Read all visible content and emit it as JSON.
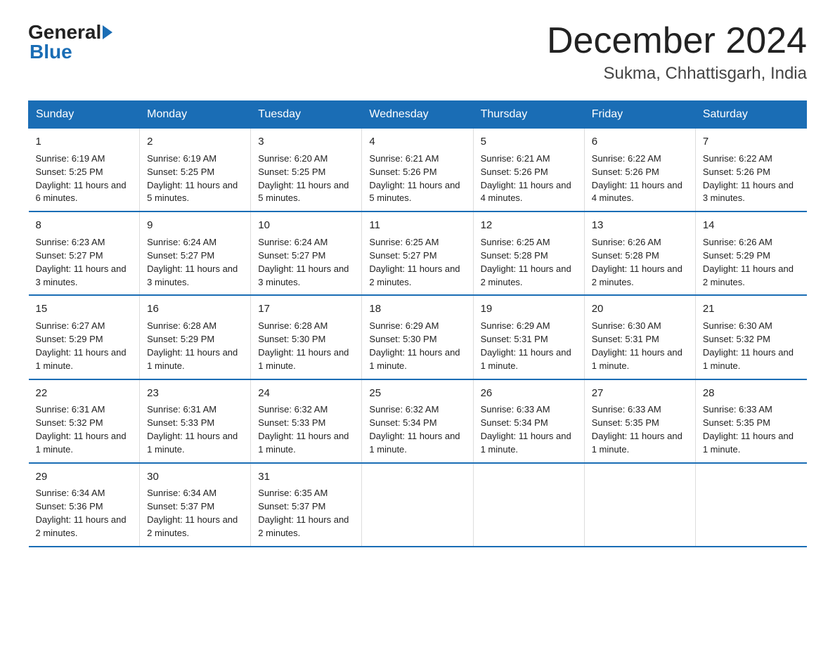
{
  "header": {
    "logo_general": "General",
    "logo_blue": "Blue",
    "month": "December 2024",
    "location": "Sukma, Chhattisgarh, India"
  },
  "days_of_week": [
    "Sunday",
    "Monday",
    "Tuesday",
    "Wednesday",
    "Thursday",
    "Friday",
    "Saturday"
  ],
  "weeks": [
    [
      {
        "day": "1",
        "sunrise": "6:19 AM",
        "sunset": "5:25 PM",
        "daylight": "11 hours and 6 minutes."
      },
      {
        "day": "2",
        "sunrise": "6:19 AM",
        "sunset": "5:25 PM",
        "daylight": "11 hours and 5 minutes."
      },
      {
        "day": "3",
        "sunrise": "6:20 AM",
        "sunset": "5:25 PM",
        "daylight": "11 hours and 5 minutes."
      },
      {
        "day": "4",
        "sunrise": "6:21 AM",
        "sunset": "5:26 PM",
        "daylight": "11 hours and 5 minutes."
      },
      {
        "day": "5",
        "sunrise": "6:21 AM",
        "sunset": "5:26 PM",
        "daylight": "11 hours and 4 minutes."
      },
      {
        "day": "6",
        "sunrise": "6:22 AM",
        "sunset": "5:26 PM",
        "daylight": "11 hours and 4 minutes."
      },
      {
        "day": "7",
        "sunrise": "6:22 AM",
        "sunset": "5:26 PM",
        "daylight": "11 hours and 3 minutes."
      }
    ],
    [
      {
        "day": "8",
        "sunrise": "6:23 AM",
        "sunset": "5:27 PM",
        "daylight": "11 hours and 3 minutes."
      },
      {
        "day": "9",
        "sunrise": "6:24 AM",
        "sunset": "5:27 PM",
        "daylight": "11 hours and 3 minutes."
      },
      {
        "day": "10",
        "sunrise": "6:24 AM",
        "sunset": "5:27 PM",
        "daylight": "11 hours and 3 minutes."
      },
      {
        "day": "11",
        "sunrise": "6:25 AM",
        "sunset": "5:27 PM",
        "daylight": "11 hours and 2 minutes."
      },
      {
        "day": "12",
        "sunrise": "6:25 AM",
        "sunset": "5:28 PM",
        "daylight": "11 hours and 2 minutes."
      },
      {
        "day": "13",
        "sunrise": "6:26 AM",
        "sunset": "5:28 PM",
        "daylight": "11 hours and 2 minutes."
      },
      {
        "day": "14",
        "sunrise": "6:26 AM",
        "sunset": "5:29 PM",
        "daylight": "11 hours and 2 minutes."
      }
    ],
    [
      {
        "day": "15",
        "sunrise": "6:27 AM",
        "sunset": "5:29 PM",
        "daylight": "11 hours and 1 minute."
      },
      {
        "day": "16",
        "sunrise": "6:28 AM",
        "sunset": "5:29 PM",
        "daylight": "11 hours and 1 minute."
      },
      {
        "day": "17",
        "sunrise": "6:28 AM",
        "sunset": "5:30 PM",
        "daylight": "11 hours and 1 minute."
      },
      {
        "day": "18",
        "sunrise": "6:29 AM",
        "sunset": "5:30 PM",
        "daylight": "11 hours and 1 minute."
      },
      {
        "day": "19",
        "sunrise": "6:29 AM",
        "sunset": "5:31 PM",
        "daylight": "11 hours and 1 minute."
      },
      {
        "day": "20",
        "sunrise": "6:30 AM",
        "sunset": "5:31 PM",
        "daylight": "11 hours and 1 minute."
      },
      {
        "day": "21",
        "sunrise": "6:30 AM",
        "sunset": "5:32 PM",
        "daylight": "11 hours and 1 minute."
      }
    ],
    [
      {
        "day": "22",
        "sunrise": "6:31 AM",
        "sunset": "5:32 PM",
        "daylight": "11 hours and 1 minute."
      },
      {
        "day": "23",
        "sunrise": "6:31 AM",
        "sunset": "5:33 PM",
        "daylight": "11 hours and 1 minute."
      },
      {
        "day": "24",
        "sunrise": "6:32 AM",
        "sunset": "5:33 PM",
        "daylight": "11 hours and 1 minute."
      },
      {
        "day": "25",
        "sunrise": "6:32 AM",
        "sunset": "5:34 PM",
        "daylight": "11 hours and 1 minute."
      },
      {
        "day": "26",
        "sunrise": "6:33 AM",
        "sunset": "5:34 PM",
        "daylight": "11 hours and 1 minute."
      },
      {
        "day": "27",
        "sunrise": "6:33 AM",
        "sunset": "5:35 PM",
        "daylight": "11 hours and 1 minute."
      },
      {
        "day": "28",
        "sunrise": "6:33 AM",
        "sunset": "5:35 PM",
        "daylight": "11 hours and 1 minute."
      }
    ],
    [
      {
        "day": "29",
        "sunrise": "6:34 AM",
        "sunset": "5:36 PM",
        "daylight": "11 hours and 2 minutes."
      },
      {
        "day": "30",
        "sunrise": "6:34 AM",
        "sunset": "5:37 PM",
        "daylight": "11 hours and 2 minutes."
      },
      {
        "day": "31",
        "sunrise": "6:35 AM",
        "sunset": "5:37 PM",
        "daylight": "11 hours and 2 minutes."
      },
      null,
      null,
      null,
      null
    ]
  ]
}
